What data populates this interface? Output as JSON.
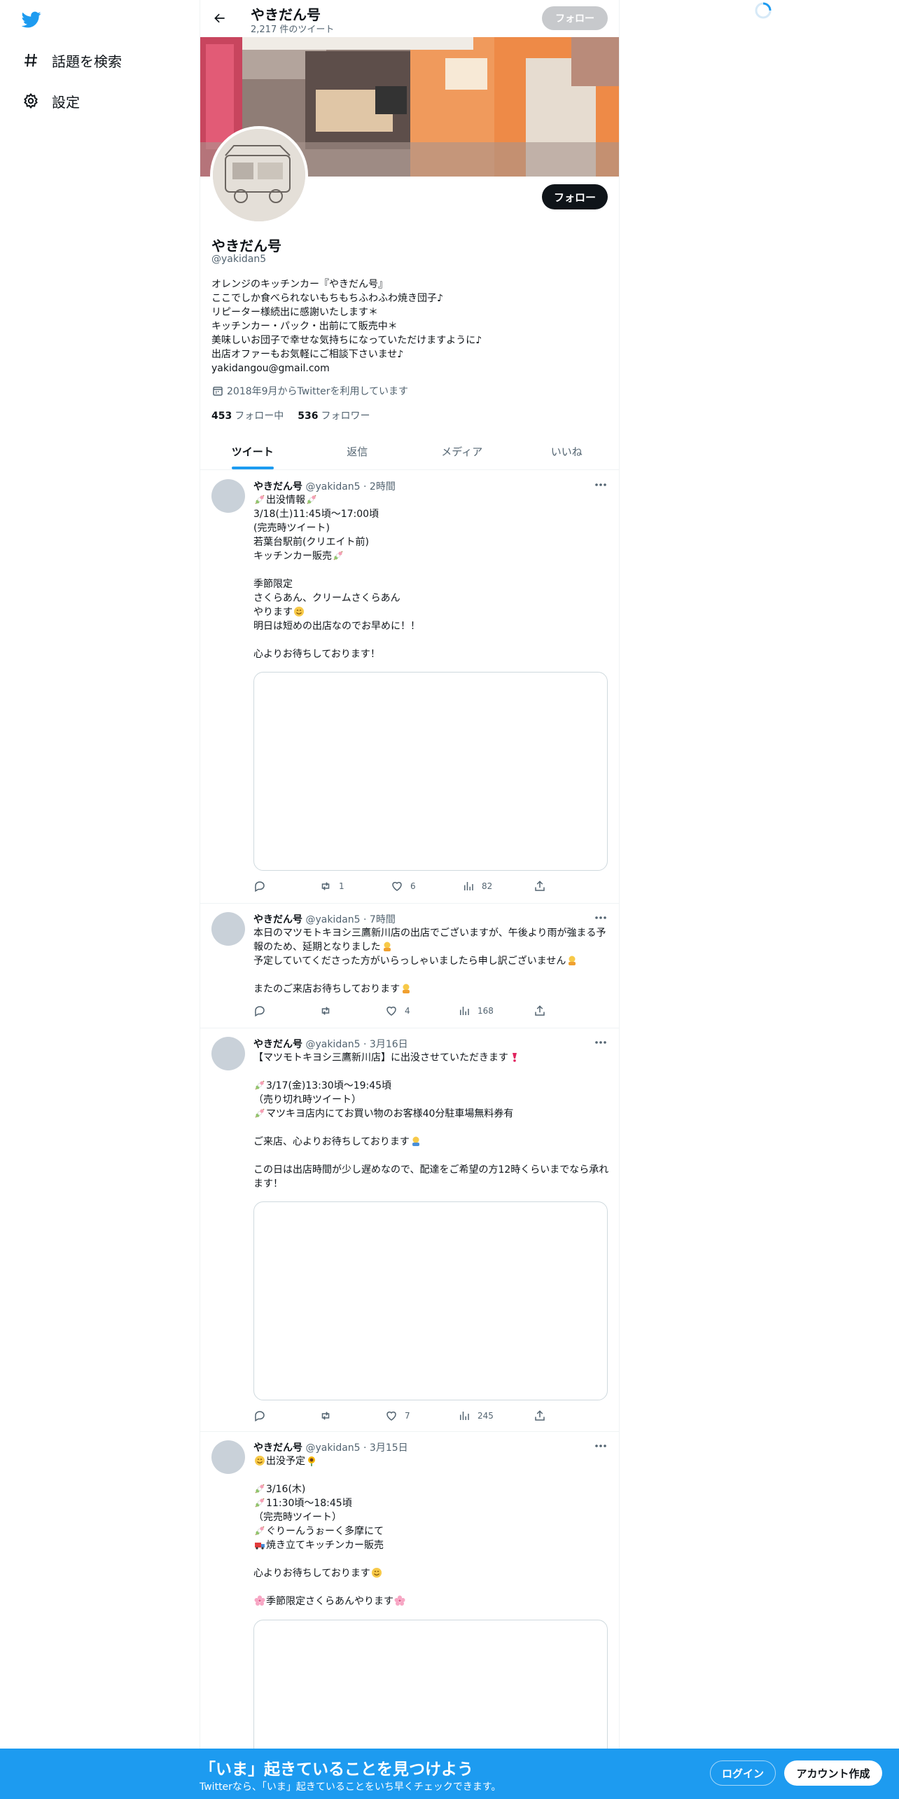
{
  "nav": {
    "explore_label": "話題を検索",
    "settings_label": "設定"
  },
  "topbar": {
    "name": "やきだん号",
    "tweet_count": "2,217 件のツイート",
    "follow_label": "フォロー"
  },
  "profile": {
    "follow_label": "フォロー",
    "name": "やきだん号",
    "handle": "@yakidan5",
    "bio": [
      "オレンジのキッチンカー『やきだん号』",
      "ここでしか食べられないもちもちふわふわ焼き団子♪",
      "リピーター様続出に感謝いたします＊",
      "キッチンカー・パック・出前にて販売中＊",
      "美味しいお団子で幸せな気持ちになっていただけますように♪",
      "出店オファーもお気軽にご相談下さいませ♪",
      "yakidangou@gmail.com"
    ],
    "joined": "2018年9月からTwitterを利用しています",
    "following_count": "453",
    "following_label": "フォロー中",
    "followers_count": "536",
    "followers_label": "フォロワー"
  },
  "tabs": [
    {
      "label": "ツイート"
    },
    {
      "label": "返信"
    },
    {
      "label": "メディア"
    },
    {
      "label": "いいね"
    }
  ],
  "tweets": [
    {
      "name": "やきだん号",
      "meta": "@yakidan5 · 2時間",
      "lines": [
        "出没情報",
        "3/18(土)11:45頃〜17:00頃",
        "(完売時ツイート)",
        "若葉台駅前(クリエイト前)",
        "キッチンカー販売",
        "",
        "季節限定",
        "さくらあん、クリームさくらあん",
        "やります",
        "明日は短めの出店なのでお早めに！！",
        "",
        "心よりお待ちしております！"
      ],
      "retweets": "1",
      "likes": "6",
      "views": "82"
    },
    {
      "name": "やきだん号",
      "meta": "@yakidan5 · 7時間",
      "lines": [
        "本日のマツモトキヨシ三鷹新川店の出店でございますが、午後より雨が強まる予報のため、延期となりました",
        "予定していてくださった方がいらっしゃいましたら申し訳ございません",
        "",
        "またのご来店お待ちしております"
      ],
      "retweets": "",
      "likes": "4",
      "views": "168"
    },
    {
      "name": "やきだん号",
      "meta": "@yakidan5 · 3月16日",
      "lines": [
        "【マツモトキヨシ三鷹新川店】に出没させていただきます",
        "",
        "3/17(金)13:30頃〜19:45頃",
        "（売り切れ時ツイート）",
        "マツキヨ店内にてお買い物のお客様40分駐車場無料券有",
        "",
        "ご来店、心よりお待ちしております",
        "",
        "この日は出店時間が少し遅めなので、配達をご希望の方12時くらいまでなら承れます！"
      ],
      "retweets": "",
      "likes": "7",
      "views": "245"
    },
    {
      "name": "やきだん号",
      "meta": "@yakidan5 · 3月15日",
      "lines": [
        "出没予定",
        "",
        "3/16(木)",
        "11:30頃〜18:45頃",
        "（完売時ツイート）",
        "ぐりーんうぉーく多摩にて",
        "焼き立てキッチンカー販売",
        "",
        "心よりお待ちしております",
        "",
        "季節限定さくらあんやります"
      ]
    }
  ],
  "bottombar": {
    "title": "「いま」起きていることを見つけよう",
    "subtitle": "Twitterなら、「いま」起きていることをいち早くチェックできます。",
    "login_label": "ログイン",
    "signup_label": "アカウント作成"
  }
}
